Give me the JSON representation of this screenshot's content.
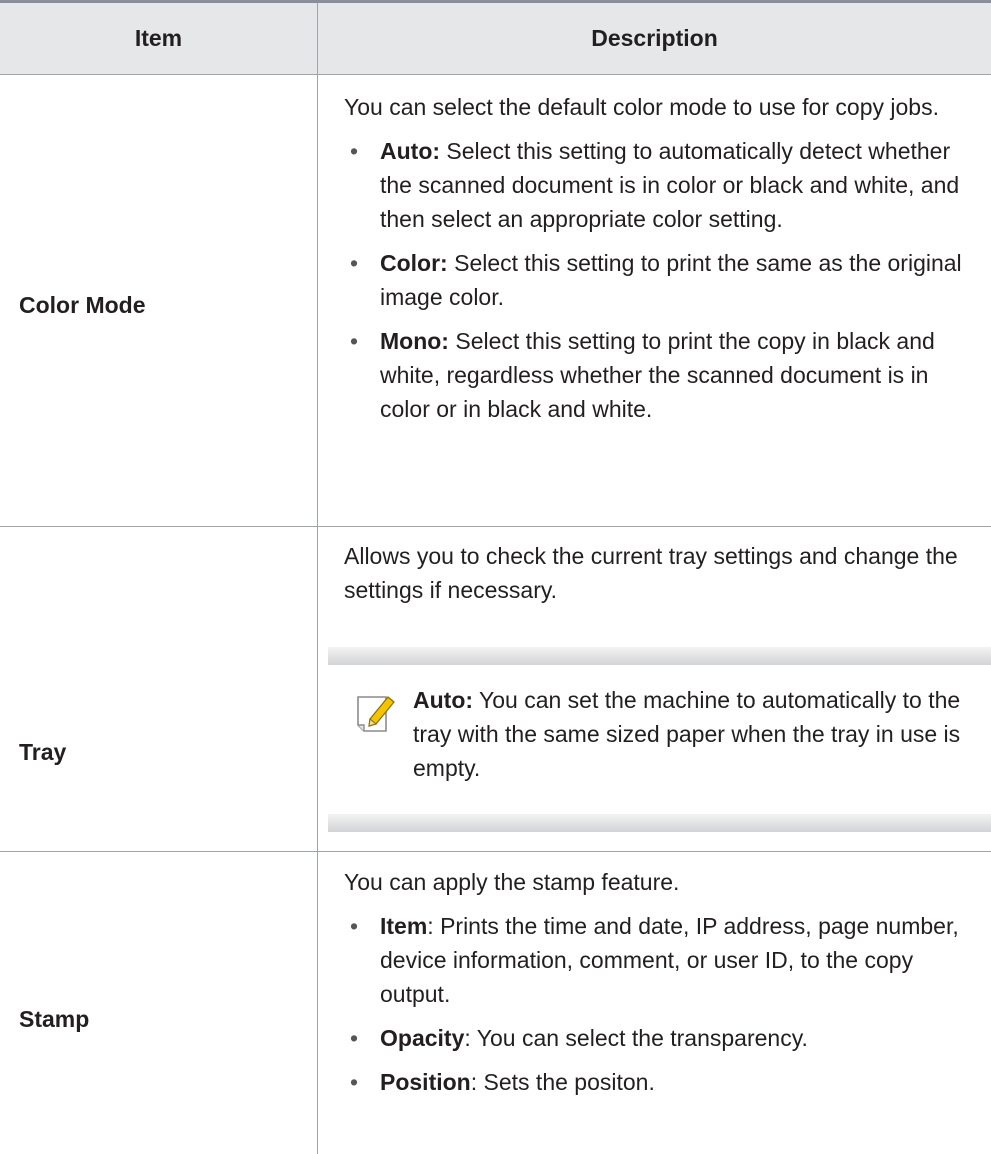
{
  "header": {
    "item": "Item",
    "description": "Description"
  },
  "rows": [
    {
      "item": "Color Mode",
      "intro": "You can select the default color mode to use for copy jobs.",
      "bullets": [
        {
          "term": "Auto:",
          "text": " Select this setting to automatically detect whether the scanned document is in color or black and white, and then select an appropriate color setting."
        },
        {
          "term": "Color:",
          "text": " Select this setting to print the same as the original image color."
        },
        {
          "term": "Mono:",
          "text": " Select this setting to print the copy in black and white, regardless whether the scanned document is in color or in black and white."
        }
      ]
    },
    {
      "item": "Tray",
      "intro": "Allows you to check the current tray settings and change the settings if necessary.",
      "note": {
        "term": "Auto:",
        "text": " You can set the machine to automatically to the tray with the same sized paper when the tray in use is empty.",
        "icon": "note-pencil-icon"
      }
    },
    {
      "item": "Stamp",
      "intro": "You can apply the stamp feature.",
      "bullets": [
        {
          "term": "Item",
          "text": ": Prints the time and date, IP address, page number, device information, comment, or user ID, to the copy output."
        },
        {
          "term": "Opacity",
          "text": ": You can select the transparency."
        },
        {
          "term": "Position",
          "text": ": Sets the positon."
        }
      ]
    }
  ],
  "colors": {
    "header_bg": "#e6e7e9",
    "rule": "#9fa3aa",
    "text": "#231f20"
  }
}
